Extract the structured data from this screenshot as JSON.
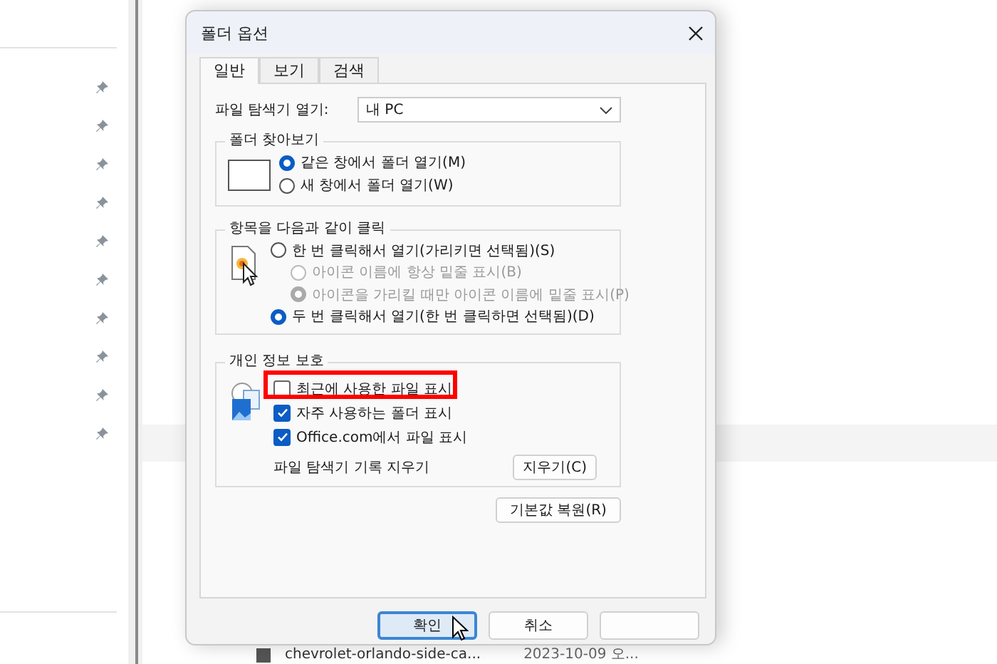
{
  "explorer": {
    "file_row": {
      "name": "chevrolet-orlando-side-ca...",
      "date": "2023-10-09 오..."
    }
  },
  "dialog": {
    "title": "폴더 옵션",
    "tabs": [
      {
        "label": "일반",
        "selected": true
      },
      {
        "label": "보기",
        "selected": false
      },
      {
        "label": "검색",
        "selected": false
      }
    ],
    "open_explorer": {
      "label": "파일 탐색기 열기:",
      "value": "내 PC"
    },
    "browse_group": {
      "title": "폴더 찾아보기",
      "options": [
        {
          "label": "같은 창에서 폴더 열기(M)",
          "selected": true,
          "disabled": false
        },
        {
          "label": "새 창에서 폴더 열기(W)",
          "selected": false,
          "disabled": false
        }
      ]
    },
    "click_group": {
      "title": "항목을 다음과 같이 클릭",
      "options": [
        {
          "label": "한 번 클릭해서 열기(가리키면 선택됨)(S)",
          "selected": false,
          "disabled": false,
          "children": [
            {
              "label": "아이콘 이름에 항상 밑줄 표시(B)",
              "selected": false,
              "disabled": true
            },
            {
              "label": "아이콘을 가리킬 때만 아이콘 이름에 밑줄 표시(P)",
              "selected": true,
              "disabled": true
            }
          ]
        },
        {
          "label": "두 번 클릭해서 열기(한 번 클릭하면 선택됨)(D)",
          "selected": true,
          "disabled": false
        }
      ]
    },
    "privacy_group": {
      "title": "개인 정보 보호",
      "checkboxes": [
        {
          "label": "최근에 사용한 파일 표시",
          "checked": false,
          "highlighted": true
        },
        {
          "label": "자주 사용하는 폴더 표시",
          "checked": true,
          "highlighted": false
        },
        {
          "label": "Office.com에서 파일 표시",
          "checked": true,
          "highlighted": false
        }
      ],
      "clear_label": "파일 탐색기 기록 지우기",
      "clear_button": "지우기(C)"
    },
    "restore_button": "기본값 복원(R)",
    "buttons": [
      {
        "label": "확인",
        "focused": true
      },
      {
        "label": "취소",
        "focused": false
      },
      {
        "focused": false
      }
    ]
  }
}
